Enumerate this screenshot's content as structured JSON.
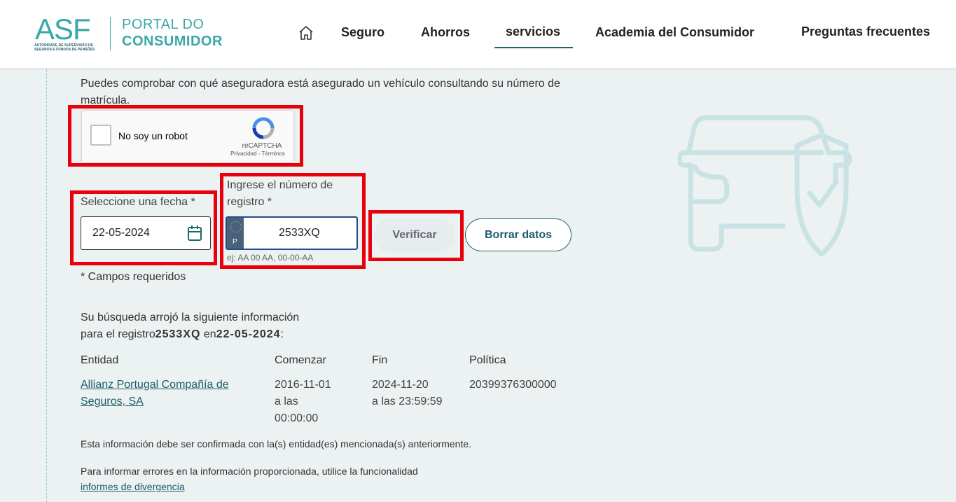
{
  "header": {
    "logo_abbr": "ASF",
    "logo_sub": "AUTORIDADE DE SUPERVISÃO DE SEGUROS E FUNDOS DE PENSÕES",
    "portal_line1": "PORTAL DO",
    "portal_line2": "CONSUMIDOR",
    "nav": [
      {
        "label": "Seguro"
      },
      {
        "label": "Ahorros"
      },
      {
        "label": "servicios",
        "active": true
      },
      {
        "label": "Academia del Consumidor"
      },
      {
        "label": "Preguntas frecuentes"
      }
    ]
  },
  "intro": "Puedes comprobar con qué aseguradora está asegurado un vehículo consultando su número de matrícula.",
  "captcha": {
    "label": "No soy un robot",
    "brand": "reCAPTCHA",
    "links": "Privacidad - Términos"
  },
  "form": {
    "date_label": "Seleccione una fecha *",
    "date_value": "22-05-2024",
    "plate_label": "Ingrese el número de registro *",
    "plate_value": "2533XQ",
    "plate_country": "P",
    "plate_hint": "ej: AA 00 AA, 00-00-AA",
    "verify_label": "Verificar",
    "clear_label": "Borrar datos",
    "required_note": "* Campos requeridos"
  },
  "result": {
    "line1": "Su búsqueda arrojó la siguiente información",
    "line2_prefix": "para el registro",
    "registration": "2533XQ",
    "line2_mid": "en",
    "date": "22-05-2024",
    "line2_suffix": ":",
    "headers": {
      "entity": "Entidad",
      "start": "Comenzar",
      "end": "Fin",
      "policy": "Política"
    },
    "row": {
      "entity_line1": "Allianz Portugal Compañía de",
      "entity_line2": "Seguros, SA",
      "start_date": "2016-11-01",
      "start_at": "a las",
      "start_time": "00:00:00",
      "end_date": "2024-11-20",
      "end_time": "a las 23:59:59",
      "policy": "20399376300000"
    }
  },
  "confirm_note": "Esta información debe ser confirmada con la(s) entidad(es) mencionada(s) anteriormente.",
  "report": {
    "text": "Para informar errores en la información proporcionada, utilice la funcionalidad",
    "link": "informes de divergencia"
  },
  "colors": {
    "accent": "#1b6b6b",
    "highlight": "#e8000b",
    "background": "#ecf1f1"
  }
}
